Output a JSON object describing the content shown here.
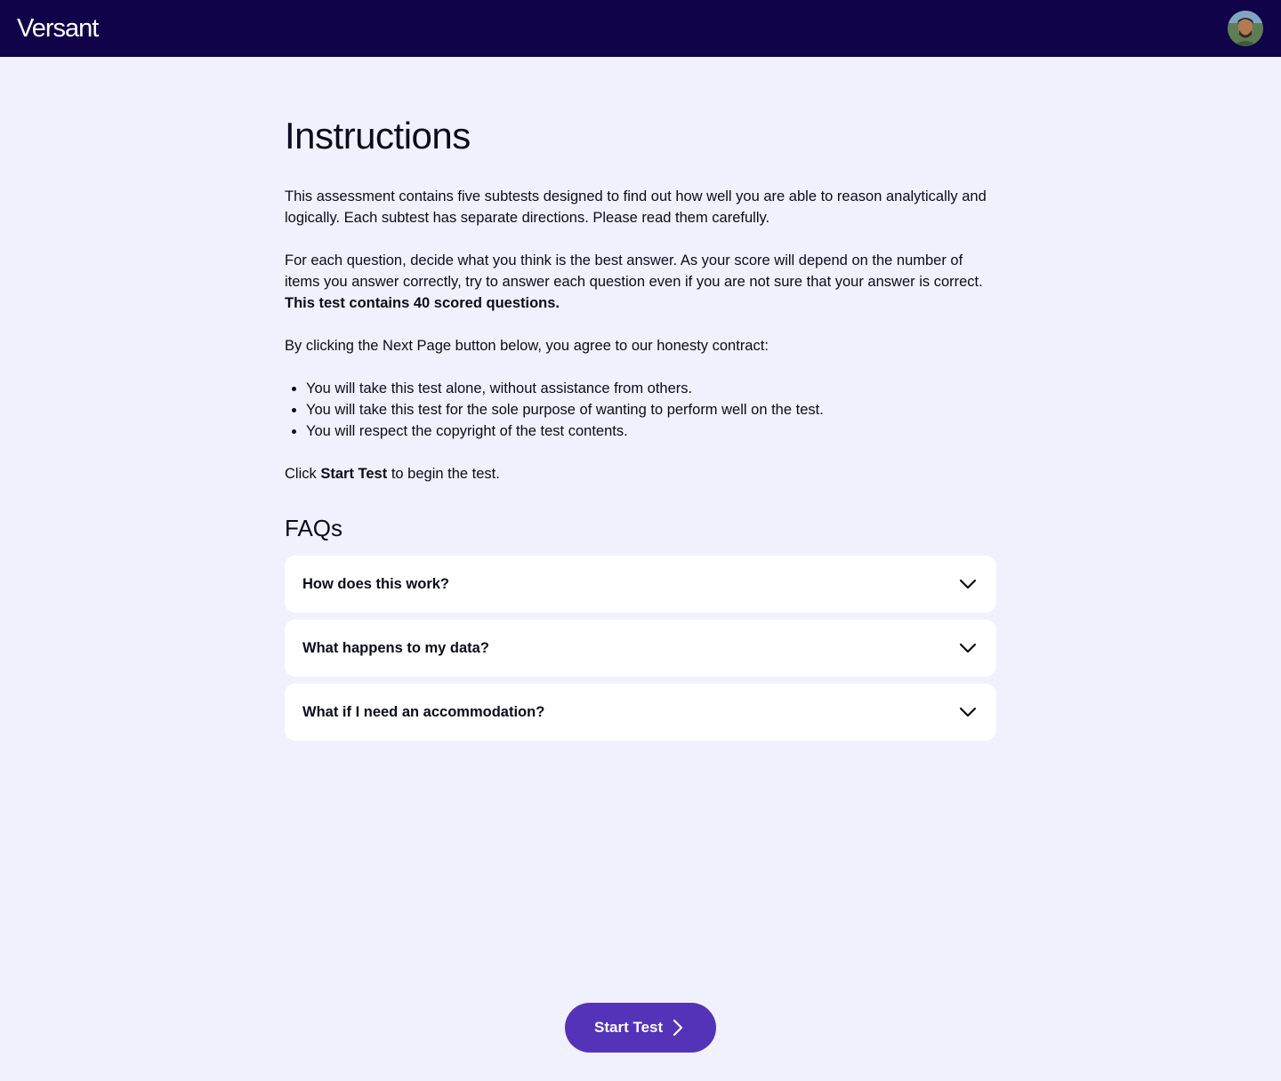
{
  "header": {
    "logo_text": "Versant",
    "avatar_icon": "user-avatar"
  },
  "main": {
    "title": "Instructions",
    "para1": "This assessment contains five subtests designed to find out how well you are able to reason analytically and logically. Each subtest has separate directions. Please read them carefully.",
    "para2": "For each question, decide what you think is the best answer. As your score will depend on the number of items you answer correctly, try to answer each question even if you are not sure that your answer is correct.",
    "para2_bold": "This test contains 40 scored questions.",
    "para3": "By clicking the Next Page button below, you agree to our honesty contract:",
    "rules": [
      "You will take this test alone, without assistance from others.",
      "You will take this test for the sole purpose of wanting to perform well on the test.",
      "You will respect the copyright of the test contents."
    ],
    "para4_prefix": "Click ",
    "para4_bold": "Start Test",
    "para4_suffix": " to begin the test."
  },
  "faq": {
    "title": "FAQs",
    "items": [
      {
        "question": "How does this work?",
        "icon": "chevron-down-icon"
      },
      {
        "question": "What happens to my data?",
        "icon": "chevron-down-icon"
      },
      {
        "question": "What if I need an accommodation?",
        "icon": "chevron-down-icon"
      }
    ]
  },
  "footer": {
    "start_label": "Start Test",
    "start_icon": "chevron-right-icon"
  },
  "colors": {
    "topbar": "#10034a",
    "background": "#f1f1fe",
    "button": "#5533b8",
    "card": "#ffffff",
    "text": "#0b0b1e"
  }
}
